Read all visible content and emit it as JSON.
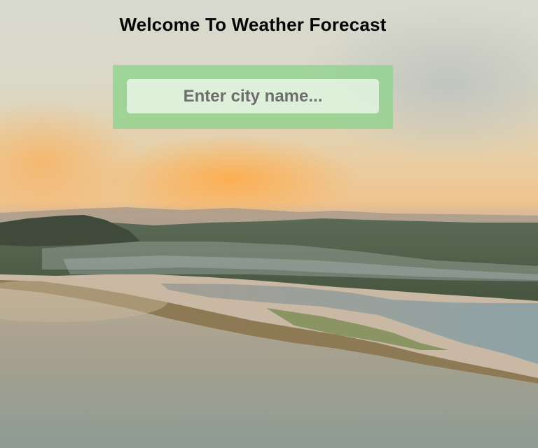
{
  "page": {
    "title": "Welcome To Weather Forecast"
  },
  "search": {
    "placeholder": "Enter city name...",
    "value": ""
  },
  "background": {
    "description_icon": "landscape-photo",
    "sky_color": "#d8d9cf",
    "glow_color": "#f7b564",
    "land_color": "#4f5a44",
    "water_color": "#8f9b8f"
  }
}
